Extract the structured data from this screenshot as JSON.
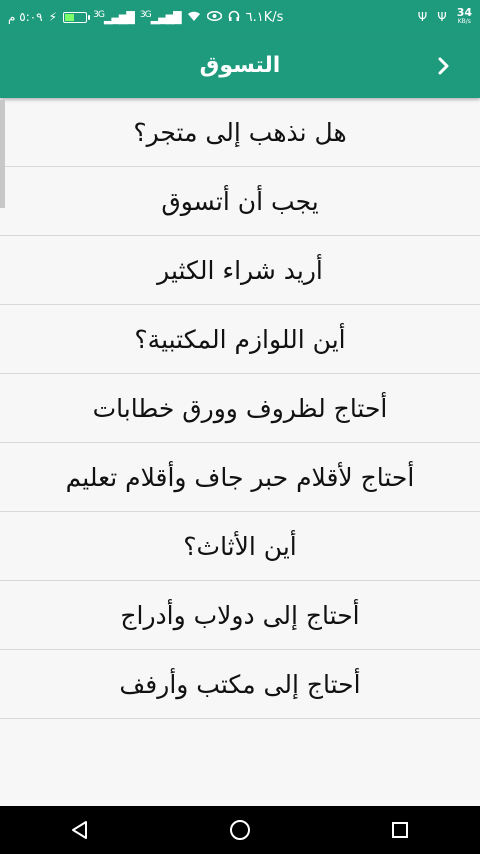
{
  "status_bar": {
    "time": "٥:٠٩ م",
    "battery_level": "٤٠",
    "signal_1": "3G",
    "signal_2": "3G",
    "net_speed": "٦.١K/s",
    "right_speed_value": "34",
    "right_speed_unit": "KB/s"
  },
  "header": {
    "title": "التسوق",
    "back_icon": "chevron-right-icon"
  },
  "list": {
    "items": [
      "هل نذهب إلى متجر؟",
      "يجب أن أتسوق",
      "أريد شراء الكثير",
      "أين اللوازم المكتبية؟",
      "أحتاج لظروف وورق خطابات",
      "أحتاج لأقلام حبر جاف وأقلام تعليم",
      "أين الأثاث؟",
      "أحتاج إلى دولاب وأدراج",
      "أحتاج إلى مكتب وأرفف"
    ]
  },
  "colors": {
    "primary": "#1e9b7c",
    "background": "#f7f7f7",
    "divider": "#d9d9d9"
  },
  "nav": {
    "back": "nav-back-icon",
    "home": "nav-home-icon",
    "recents": "nav-recents-icon"
  }
}
